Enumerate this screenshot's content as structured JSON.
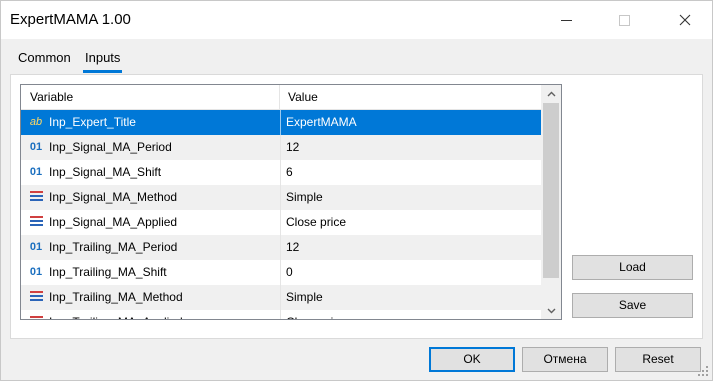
{
  "window": {
    "title": "ExpertMAMA 1.00"
  },
  "tabs": [
    {
      "label": "Common",
      "active": false
    },
    {
      "label": "Inputs",
      "active": true
    }
  ],
  "grid": {
    "headers": {
      "variable": "Variable",
      "value": "Value"
    },
    "rows": [
      {
        "icon": "ab",
        "icon_name": "string-type-icon",
        "name": "Inp_Expert_Title",
        "value": "ExpertMAMA",
        "selected": true
      },
      {
        "icon": "01",
        "icon_name": "integer-type-icon",
        "name": "Inp_Signal_MA_Period",
        "value": "12"
      },
      {
        "icon": "01",
        "icon_name": "integer-type-icon",
        "name": "Inp_Signal_MA_Shift",
        "value": "6"
      },
      {
        "icon": "enum",
        "icon_name": "enum-type-icon",
        "name": "Inp_Signal_MA_Method",
        "value": "Simple"
      },
      {
        "icon": "enum",
        "icon_name": "enum-type-icon",
        "name": "Inp_Signal_MA_Applied",
        "value": "Close price"
      },
      {
        "icon": "01",
        "icon_name": "integer-type-icon",
        "name": "Inp_Trailing_MA_Period",
        "value": "12"
      },
      {
        "icon": "01",
        "icon_name": "integer-type-icon",
        "name": "Inp_Trailing_MA_Shift",
        "value": "0"
      },
      {
        "icon": "enum",
        "icon_name": "enum-type-icon",
        "name": "Inp_Trailing_MA_Method",
        "value": "Simple"
      },
      {
        "icon": "enum",
        "icon_name": "enum-type-icon",
        "name": "Inp_Trailing_MA_Applied",
        "value": "Close price"
      }
    ]
  },
  "side_buttons": {
    "load": "Load",
    "save": "Save"
  },
  "footer_buttons": {
    "ok": "OK",
    "cancel": "Отмена",
    "reset": "Reset"
  },
  "colors": {
    "accent": "#0078d7",
    "selected_row": "#0078d7",
    "alt_row": "#f0f0f0"
  }
}
